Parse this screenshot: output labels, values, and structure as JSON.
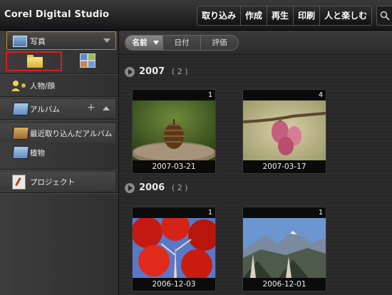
{
  "app": {
    "title": "Corel Digital Studio"
  },
  "nav": {
    "items": [
      "取り込み",
      "作成",
      "再生",
      "印刷",
      "人と楽しむ"
    ]
  },
  "sidebar": {
    "library_selector": "写真",
    "people": "人物/顔",
    "album_header": "アルバム",
    "albums": [
      "最近取り込んだアルバム",
      "植物"
    ],
    "project": "プロジェクト"
  },
  "sort": {
    "name": "名前",
    "date": "日付",
    "rating": "評価"
  },
  "groups": [
    {
      "year": "2007",
      "count": "( 2 )",
      "items": [
        {
          "badge": "1",
          "date": "2007-03-21"
        },
        {
          "badge": "4",
          "date": "2007-03-17"
        }
      ]
    },
    {
      "year": "2006",
      "count": "( 2 )",
      "items": [
        {
          "badge": "1",
          "date": "2006-12-03"
        },
        {
          "badge": "1",
          "date": "2006-12-01"
        }
      ]
    }
  ],
  "colors": {
    "accent_orange": "#c8881a",
    "highlight_red": "#e01a1a"
  }
}
